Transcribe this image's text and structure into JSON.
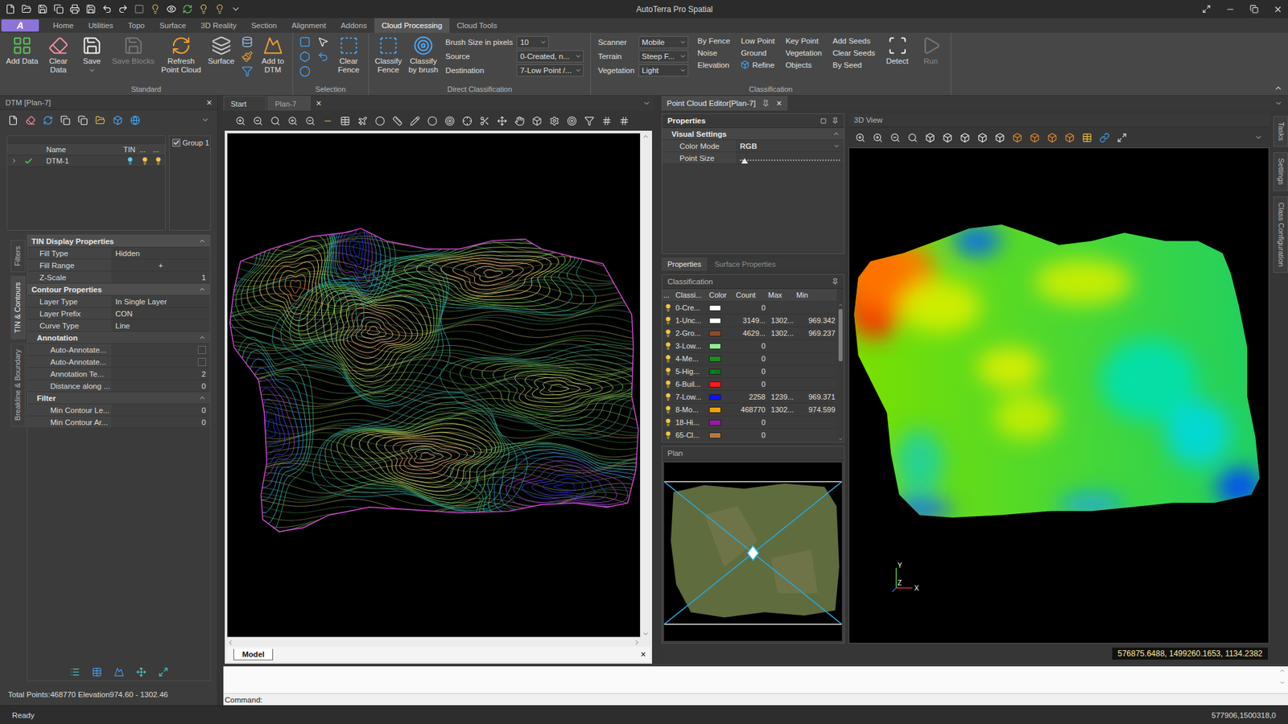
{
  "window": {
    "title": "AutoTerra Pro Spatial"
  },
  "app_button": {
    "label": "A"
  },
  "ribbon_tabs": [
    {
      "label": "Home",
      "selected": false
    },
    {
      "label": "Utilities",
      "selected": false
    },
    {
      "label": "Topo",
      "selected": false
    },
    {
      "label": "Surface",
      "selected": false
    },
    {
      "label": "3D Reality",
      "selected": false
    },
    {
      "label": "Section",
      "selected": false
    },
    {
      "label": "Alignment",
      "selected": false
    },
    {
      "label": "Addons",
      "selected": false
    },
    {
      "label": "Cloud Processing",
      "selected": true
    },
    {
      "label": "Cloud Tools",
      "selected": false
    }
  ],
  "ribbon_groups": [
    {
      "label": "Standard",
      "items": [
        {
          "kind": "large",
          "lines": [
            "Add Data"
          ],
          "disabled": false,
          "dropdown": false
        },
        {
          "kind": "large",
          "lines": [
            "Clear",
            "Data"
          ],
          "disabled": false,
          "dropdown": false
        },
        {
          "kind": "large",
          "lines": [
            "Save"
          ],
          "disabled": false,
          "dropdown": true
        },
        {
          "kind": "large",
          "lines": [
            "Save Blocks"
          ],
          "disabled": true,
          "dropdown": false
        },
        {
          "kind": "large",
          "lines": [
            "Refresh",
            "Point Cloud"
          ],
          "disabled": false,
          "dropdown": false
        },
        {
          "kind": "large",
          "lines": [
            "Surface"
          ],
          "disabled": false,
          "dropdown": false
        },
        {
          "kind": "icons"
        },
        {
          "kind": "large",
          "lines": [
            "Add to",
            "DTM"
          ],
          "disabled": false,
          "dropdown": false
        }
      ]
    },
    {
      "label": "Selection",
      "items": [
        {
          "kind": "icons"
        },
        {
          "kind": "icons"
        },
        {
          "kind": "large",
          "lines": [
            "Clear",
            "Fence"
          ],
          "disabled": false,
          "dropdown": false
        }
      ]
    },
    {
      "label": "Direct Classification",
      "items": [
        {
          "kind": "large",
          "lines": [
            "Classify",
            "Fence"
          ],
          "disabled": false,
          "dropdown": false
        },
        {
          "kind": "large",
          "lines": [
            "Classify",
            "by brush"
          ],
          "disabled": false,
          "dropdown": false
        },
        {
          "kind": "fields",
          "fields": [
            {
              "label": "Brush Size in pixels",
              "value": "10"
            },
            {
              "label": "Source",
              "value": "0-Created, n..."
            },
            {
              "label": "Destination",
              "value": "7-Low Point /..."
            }
          ]
        }
      ]
    },
    {
      "label": "Classification",
      "items": [
        {
          "kind": "fields",
          "fields": [
            {
              "label": "Scanner",
              "value": "Mobile"
            },
            {
              "label": "Terrain",
              "value": "Steep F..."
            },
            {
              "label": "Vegetation",
              "value": "Light"
            }
          ]
        },
        {
          "kind": "texts",
          "texts": [
            {
              "label": "By Fence",
              "has_icon": false
            },
            {
              "label": "Noise",
              "has_icon": false
            },
            {
              "label": "Elevation",
              "has_icon": false
            }
          ]
        },
        {
          "kind": "texts",
          "texts": [
            {
              "label": "Low Point",
              "has_icon": false
            },
            {
              "label": "Ground",
              "has_icon": false
            },
            {
              "label": "Refine",
              "has_icon": true
            }
          ]
        },
        {
          "kind": "texts",
          "texts": [
            {
              "label": "Key Point",
              "has_icon": false
            },
            {
              "label": "Vegetation",
              "has_icon": false
            },
            {
              "label": "Objects",
              "has_icon": false
            }
          ]
        },
        {
          "kind": "texts",
          "texts": [
            {
              "label": "Add Seeds",
              "has_icon": false
            },
            {
              "label": "Clear Seeds",
              "has_icon": false
            },
            {
              "label": "By Seed",
              "has_icon": false
            }
          ]
        },
        {
          "kind": "large",
          "lines": [
            "Detect"
          ],
          "disabled": false,
          "dropdown": false
        },
        {
          "kind": "large",
          "lines": [
            "Run"
          ],
          "disabled": true,
          "dropdown": false
        }
      ]
    }
  ],
  "dtm_panel": {
    "title": "DTM [Plan-7]",
    "close": "×",
    "tree": {
      "columns": [
        "Name",
        "TIN",
        "...",
        "..."
      ],
      "rows": [
        {
          "name": "DTM-1",
          "expanded": false,
          "checked": true,
          "lights": [
            {
              "color": "#5bc8f5"
            },
            {
              "color": "#f5c542"
            },
            {
              "color": "#f5c542"
            }
          ]
        }
      ]
    },
    "group": {
      "label": "Group 1",
      "checked": true
    },
    "side_tabs": [
      {
        "label": "Filters",
        "selected": false
      },
      {
        "label": "TIN & Contours",
        "selected": true
      },
      {
        "label": "Breakline & Boundary",
        "selected": false
      }
    ],
    "sections": [
      {
        "title": "TIN Display Properties",
        "level": 0,
        "expanded": true,
        "rows": [
          {
            "label": "Fill Type",
            "value": "Hidden",
            "kind": "text"
          },
          {
            "label": "Fill Range",
            "value": "+",
            "kind": "button"
          },
          {
            "label": "Z-Scale",
            "value": "1",
            "kind": "number"
          }
        ]
      },
      {
        "title": "Contour Properties",
        "level": 0,
        "expanded": true,
        "rows": [
          {
            "label": "Layer Type",
            "value": "In Single Layer",
            "kind": "text"
          },
          {
            "label": "Layer Prefix",
            "value": "CON",
            "kind": "text"
          },
          {
            "label": "Curve Type",
            "value": "Line",
            "kind": "text"
          }
        ]
      },
      {
        "title": "Annotation",
        "level": 1,
        "expanded": true,
        "rows": [
          {
            "label": "Auto-Annotate...",
            "kind": "checkbox",
            "checked": false
          },
          {
            "label": "Auto-Annotate...",
            "kind": "checkbox",
            "checked": false
          },
          {
            "label": "Annotation Te...",
            "value": "2",
            "kind": "number"
          },
          {
            "label": "Distance along ...",
            "value": "0",
            "kind": "number"
          }
        ]
      },
      {
        "title": "Filter",
        "level": 1,
        "expanded": true,
        "rows": [
          {
            "label": "Min Contour Le...",
            "value": "0",
            "kind": "number"
          },
          {
            "label": "Min Contour Ar...",
            "value": "0",
            "kind": "number"
          }
        ]
      }
    ],
    "footer": "Total Points:468770 Elevation974.60 - 1302.46"
  },
  "document": {
    "tabs": [
      {
        "label": "Start",
        "selected": false
      },
      {
        "label": "Plan-7",
        "selected": true
      }
    ],
    "close": "×",
    "model_tab": "Model",
    "model_close": "×",
    "command_label": "Command:"
  },
  "editor": {
    "tab": "Point Cloud Editor[Plan-7]",
    "close": "×",
    "properties": {
      "title": "Properties",
      "section": "Visual Settings",
      "rows": [
        {
          "label": "Color Mode",
          "kind": "select",
          "value": "RGB"
        },
        {
          "label": "Point Size",
          "kind": "slider",
          "level": 0.05
        }
      ],
      "tabs": [
        {
          "label": "Properties",
          "selected": true
        },
        {
          "label": "Surface Properties",
          "selected": false
        }
      ]
    },
    "classification": {
      "title": "Classification",
      "columns": [
        "...",
        "Classi...",
        "Color",
        "Count",
        "Max",
        "Min"
      ],
      "rows": [
        {
          "name": "0-Cre...",
          "color": "#ffffff",
          "count": "0",
          "max": "",
          "min": "",
          "visible": true
        },
        {
          "name": "1-Unc...",
          "color": "#ffffff",
          "count": "3149...",
          "max": "1302...",
          "min": "969.342",
          "visible": true
        },
        {
          "name": "2-Gro...",
          "color": "#8b4a2b",
          "count": "4629...",
          "max": "1302...",
          "min": "969.237",
          "visible": true
        },
        {
          "name": "3-Low...",
          "color": "#90ee90",
          "count": "0",
          "max": "",
          "min": "",
          "visible": true
        },
        {
          "name": "4-Me...",
          "color": "#1e8c1e",
          "count": "0",
          "max": "",
          "min": "",
          "visible": true
        },
        {
          "name": "5-Hig...",
          "color": "#007a1a",
          "count": "0",
          "max": "",
          "min": "",
          "visible": true
        },
        {
          "name": "6-Buil...",
          "color": "#ff1a1a",
          "count": "0",
          "max": "",
          "min": "",
          "visible": true
        },
        {
          "name": "7-Low...",
          "color": "#1010ff",
          "count": "2258",
          "max": "1239...",
          "min": "969.371",
          "visible": true
        },
        {
          "name": "8-Mo...",
          "color": "#ffa000",
          "count": "468770",
          "max": "1302...",
          "min": "974.599",
          "visible": true
        },
        {
          "name": "18-Hi...",
          "color": "#9a1aa0",
          "count": "0",
          "max": "",
          "min": "",
          "visible": true
        },
        {
          "name": "65-Cl...",
          "color": "#b8763c",
          "count": "0",
          "max": "",
          "min": "",
          "visible": true
        }
      ]
    },
    "plan": {
      "title": "Plan"
    },
    "view3d": {
      "title": "3D View",
      "axes": [
        "Y",
        "Z",
        "X"
      ],
      "coords": "576875.6488, 1499260.1653, 1134.2382"
    },
    "side_tabs": [
      {
        "label": "Tasks"
      },
      {
        "label": "Settings"
      },
      {
        "label": "Class Configuration"
      }
    ]
  },
  "status_bar": {
    "left": "Ready",
    "right": "577906,1500318,0"
  }
}
